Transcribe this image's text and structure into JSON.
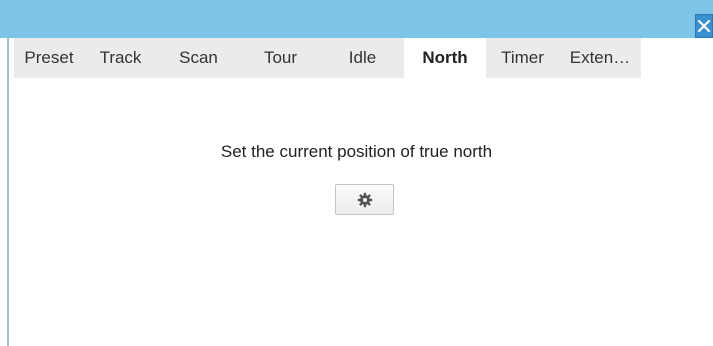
{
  "tabs": [
    {
      "label": "Preset",
      "active": false
    },
    {
      "label": "Track",
      "active": false
    },
    {
      "label": "Scan",
      "active": false
    },
    {
      "label": "Tour",
      "active": false
    },
    {
      "label": "Idle",
      "active": false
    },
    {
      "label": "North",
      "active": true
    },
    {
      "label": "Timer",
      "active": false
    },
    {
      "label": "Exten…",
      "active": false
    }
  ],
  "north_panel": {
    "description": "Set the current position of true north",
    "set_button_icon": "gear-icon"
  },
  "titlebar": {
    "close_icon": "close-icon",
    "color": "#7ec4e6"
  }
}
